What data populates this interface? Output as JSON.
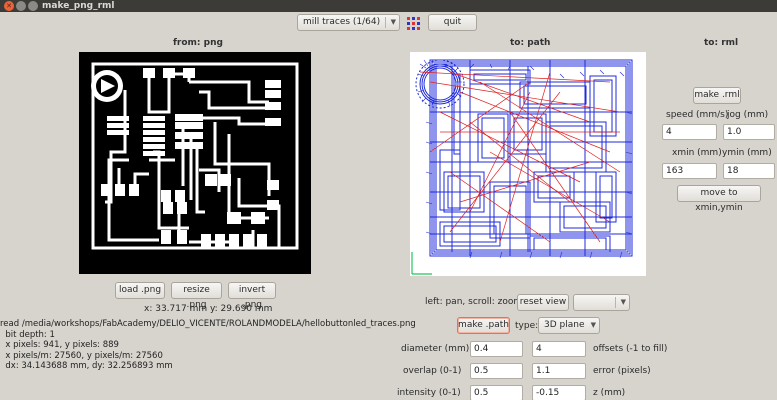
{
  "window": {
    "title": "make_png_rml"
  },
  "toolbar": {
    "mode_select": "mill traces (1/64)",
    "grid_icon": "grid-icon",
    "quit_label": "quit"
  },
  "panels": {
    "png_header": "from: png",
    "path_header": "to: path",
    "rml_header": "to: rml"
  },
  "png": {
    "load_label": "load .png",
    "resize_label": "resize .png",
    "invert_label": "invert .png",
    "cursor_readout": "x: 33.717 mm  y: 29.690 mm",
    "info": [
      "read /media/workshops/FabAcademy/DELIO_VICENTE/ROLANDMODELA/hellobuttonled_traces.png",
      "  bit depth: 1",
      "  x pixels: 941, y pixels: 889",
      "  x pixels/m: 27560, y pixels/m: 27560",
      "  dx: 34.143688 mm, dy: 32.256893 mm"
    ]
  },
  "path": {
    "hint": "left: pan, scroll: zoom",
    "reset_label": "reset view",
    "view_select": "",
    "make_path_label": "make .path",
    "type_label": "type:",
    "type_select": "3D plane",
    "diameter_label": "diameter (mm)",
    "diameter_value": "0.4",
    "offsets_value": "4",
    "offsets_label": "offsets (-1 to fill)",
    "overlap_label": "overlap (0-1)",
    "overlap_value": "0.5",
    "error_value": "1.1",
    "error_label": "error (pixels)",
    "intensity_label": "intensity (0-1)",
    "intensity_value": "0.5",
    "z_value": "-0.15",
    "z_label": "z (mm)"
  },
  "rml": {
    "make_label": "make .rml",
    "speed_label": "speed (mm/s)",
    "speed_value": "4",
    "jog_label": "jog (mm)",
    "jog_value": "1.0",
    "xmin_label": "xmin (mm)",
    "xmin_value": "163",
    "ymin_label": "ymin (mm)",
    "ymin_value": "18",
    "move_label": "move to xmin,ymin"
  },
  "colors": {
    "trace_white": "#ffffff",
    "board_black": "#000000",
    "toolpath_blue": "#1f2bd8",
    "move_red": "#e02020",
    "axis_green": "#22c55e",
    "focus_accent": "#e0735a"
  }
}
